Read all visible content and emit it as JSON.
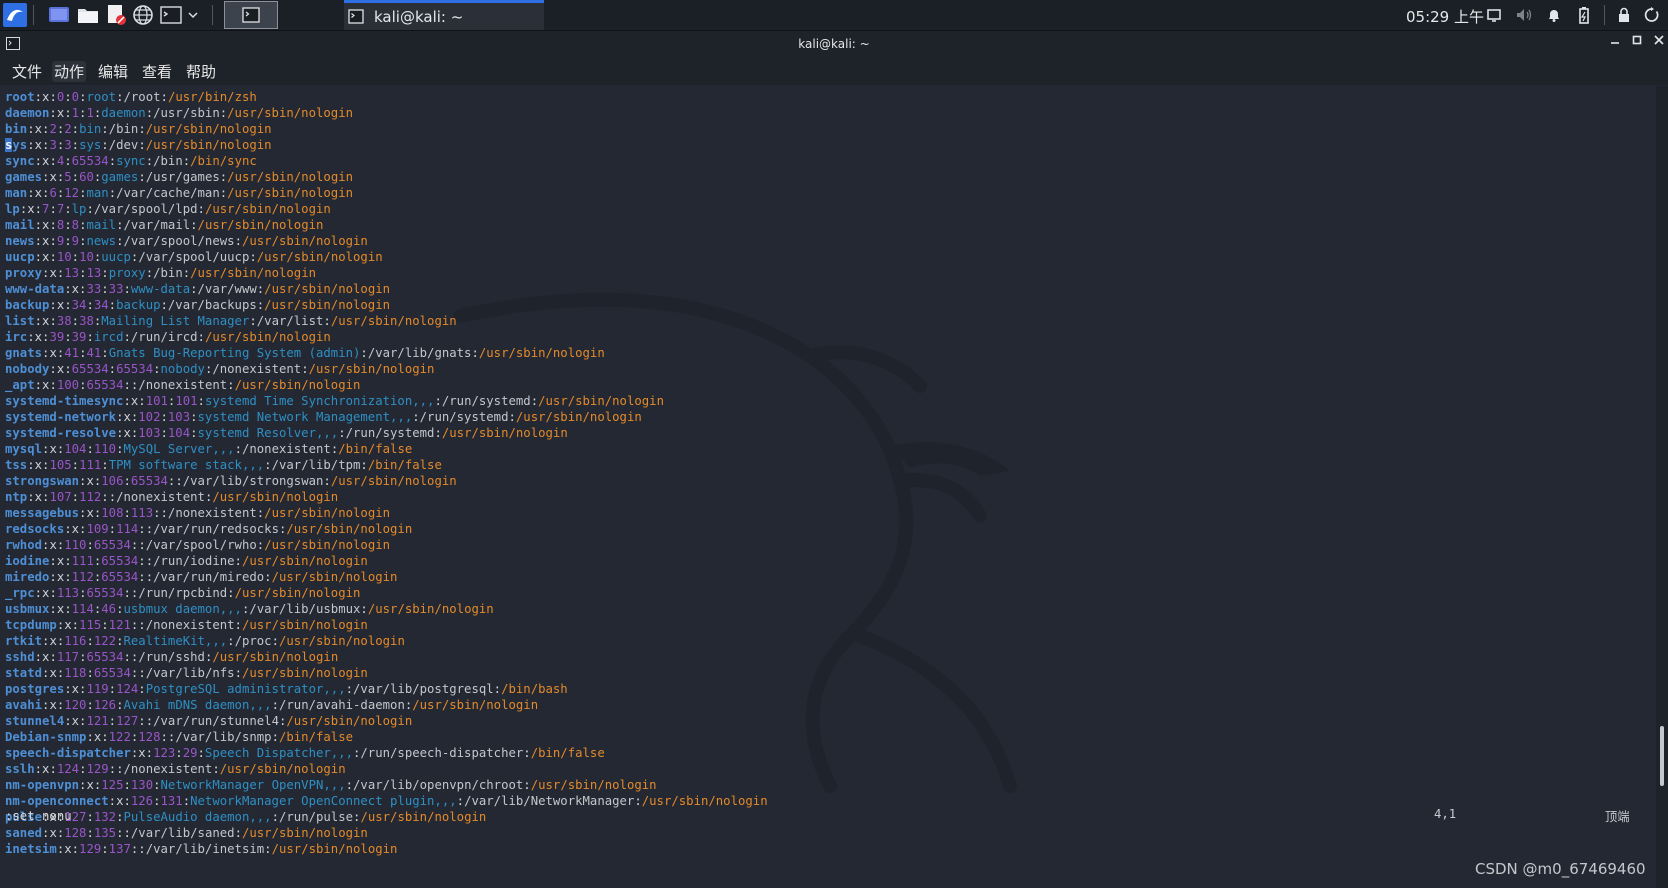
{
  "taskbar": {
    "app_title": "kali@kali: ~",
    "clock": "05:29 上午"
  },
  "window": {
    "title": "kali@kali: ~"
  },
  "menu": {
    "file": "文件",
    "action": "动作",
    "edit": "编辑",
    "view": "查看",
    "help": "帮助"
  },
  "terminal": {
    "lines": [
      [
        "root",
        "x",
        "0",
        "0",
        "root",
        "/root",
        "/usr/bin/zsh"
      ],
      [
        "daemon",
        "x",
        "1",
        "1",
        "daemon",
        "/usr/sbin",
        "/usr/sbin/nologin"
      ],
      [
        "bin",
        "x",
        "2",
        "2",
        "bin",
        "/bin",
        "/usr/sbin/nologin"
      ],
      [
        "sys",
        "x",
        "3",
        "3",
        "sys",
        "/dev",
        "/usr/sbin/nologin"
      ],
      [
        "sync",
        "x",
        "4",
        "65534",
        "sync",
        "/bin",
        "/bin/sync"
      ],
      [
        "games",
        "x",
        "5",
        "60",
        "games",
        "/usr/games",
        "/usr/sbin/nologin"
      ],
      [
        "man",
        "x",
        "6",
        "12",
        "man",
        "/var/cache/man",
        "/usr/sbin/nologin"
      ],
      [
        "lp",
        "x",
        "7",
        "7",
        "lp",
        "/var/spool/lpd",
        "/usr/sbin/nologin"
      ],
      [
        "mail",
        "x",
        "8",
        "8",
        "mail",
        "/var/mail",
        "/usr/sbin/nologin"
      ],
      [
        "news",
        "x",
        "9",
        "9",
        "news",
        "/var/spool/news",
        "/usr/sbin/nologin"
      ],
      [
        "uucp",
        "x",
        "10",
        "10",
        "uucp",
        "/var/spool/uucp",
        "/usr/sbin/nologin"
      ],
      [
        "proxy",
        "x",
        "13",
        "13",
        "proxy",
        "/bin",
        "/usr/sbin/nologin"
      ],
      [
        "www-data",
        "x",
        "33",
        "33",
        "www-data",
        "/var/www",
        "/usr/sbin/nologin"
      ],
      [
        "backup",
        "x",
        "34",
        "34",
        "backup",
        "/var/backups",
        "/usr/sbin/nologin"
      ],
      [
        "list",
        "x",
        "38",
        "38",
        "Mailing List Manager",
        "/var/list",
        "/usr/sbin/nologin"
      ],
      [
        "irc",
        "x",
        "39",
        "39",
        "ircd",
        "/run/ircd",
        "/usr/sbin/nologin"
      ],
      [
        "gnats",
        "x",
        "41",
        "41",
        "Gnats Bug-Reporting System (admin)",
        "/var/lib/gnats",
        "/usr/sbin/nologin"
      ],
      [
        "nobody",
        "x",
        "65534",
        "65534",
        "nobody",
        "/nonexistent",
        "/usr/sbin/nologin"
      ],
      [
        "_apt",
        "x",
        "100",
        "65534",
        "",
        "/nonexistent",
        "/usr/sbin/nologin"
      ],
      [
        "systemd-timesync",
        "x",
        "101",
        "101",
        "systemd Time Synchronization,,,",
        "/run/systemd",
        "/usr/sbin/nologin"
      ],
      [
        "systemd-network",
        "x",
        "102",
        "103",
        "systemd Network Management,,,",
        "/run/systemd",
        "/usr/sbin/nologin"
      ],
      [
        "systemd-resolve",
        "x",
        "103",
        "104",
        "systemd Resolver,,,",
        "/run/systemd",
        "/usr/sbin/nologin"
      ],
      [
        "mysql",
        "x",
        "104",
        "110",
        "MySQL Server,,,",
        "/nonexistent",
        "/bin/false"
      ],
      [
        "tss",
        "x",
        "105",
        "111",
        "TPM software stack,,,",
        "/var/lib/tpm",
        "/bin/false"
      ],
      [
        "strongswan",
        "x",
        "106",
        "65534",
        "",
        "/var/lib/strongswan",
        "/usr/sbin/nologin"
      ],
      [
        "ntp",
        "x",
        "107",
        "112",
        "",
        "/nonexistent",
        "/usr/sbin/nologin"
      ],
      [
        "messagebus",
        "x",
        "108",
        "113",
        "",
        "/nonexistent",
        "/usr/sbin/nologin"
      ],
      [
        "redsocks",
        "x",
        "109",
        "114",
        "",
        "/var/run/redsocks",
        "/usr/sbin/nologin"
      ],
      [
        "rwhod",
        "x",
        "110",
        "65534",
        "",
        "/var/spool/rwho",
        "/usr/sbin/nologin"
      ],
      [
        "iodine",
        "x",
        "111",
        "65534",
        "",
        "/run/iodine",
        "/usr/sbin/nologin"
      ],
      [
        "miredo",
        "x",
        "112",
        "65534",
        "",
        "/var/run/miredo",
        "/usr/sbin/nologin"
      ],
      [
        "_rpc",
        "x",
        "113",
        "65534",
        "",
        "/run/rpcbind",
        "/usr/sbin/nologin"
      ],
      [
        "usbmux",
        "x",
        "114",
        "46",
        "usbmux daemon,,,",
        "/var/lib/usbmux",
        "/usr/sbin/nologin"
      ],
      [
        "tcpdump",
        "x",
        "115",
        "121",
        "",
        "/nonexistent",
        "/usr/sbin/nologin"
      ],
      [
        "rtkit",
        "x",
        "116",
        "122",
        "RealtimeKit,,,",
        "/proc",
        "/usr/sbin/nologin"
      ],
      [
        "sshd",
        "x",
        "117",
        "65534",
        "",
        "/run/sshd",
        "/usr/sbin/nologin"
      ],
      [
        "statd",
        "x",
        "118",
        "65534",
        "",
        "/var/lib/nfs",
        "/usr/sbin/nologin"
      ],
      [
        "postgres",
        "x",
        "119",
        "124",
        "PostgreSQL administrator,,,",
        "/var/lib/postgresql",
        "/bin/bash"
      ],
      [
        "avahi",
        "x",
        "120",
        "126",
        "Avahi mDNS daemon,,,",
        "/run/avahi-daemon",
        "/usr/sbin/nologin"
      ],
      [
        "stunnel4",
        "x",
        "121",
        "127",
        "",
        "/var/run/stunnel4",
        "/usr/sbin/nologin"
      ],
      [
        "Debian-snmp",
        "x",
        "122",
        "128",
        "",
        "/var/lib/snmp",
        "/bin/false"
      ],
      [
        "speech-dispatcher",
        "x",
        "123",
        "29",
        "Speech Dispatcher,,,",
        "/run/speech-dispatcher",
        "/bin/false"
      ],
      [
        "sslh",
        "x",
        "124",
        "129",
        "",
        "/nonexistent",
        "/usr/sbin/nologin"
      ],
      [
        "nm-openvpn",
        "x",
        "125",
        "130",
        "NetworkManager OpenVPN,,,",
        "/var/lib/openvpn/chroot",
        "/usr/sbin/nologin"
      ],
      [
        "nm-openconnect",
        "x",
        "126",
        "131",
        "NetworkManager OpenConnect plugin,,,",
        "/var/lib/NetworkManager",
        "/usr/sbin/nologin"
      ],
      [
        "pulse",
        "x",
        "127",
        "132",
        "PulseAudio daemon,,,",
        "/run/pulse",
        "/usr/sbin/nologin"
      ],
      [
        "saned",
        "x",
        "128",
        "135",
        "",
        "/var/lib/saned",
        "/usr/sbin/nologin"
      ],
      [
        "inetsim",
        "x",
        "129",
        "137",
        "",
        "/var/lib/inetsim",
        "/usr/sbin/nologin"
      ]
    ],
    "command_line": ":set nonu",
    "cursor_position": "4,1",
    "scroll_position": "顶端"
  },
  "watermark": "CSDN @m0_67469460",
  "colors": {
    "background": "#232832",
    "username": "#4e8fd6",
    "id": "#9a55c8",
    "gecos": "#2f8fc5",
    "shell": "#e38a2b",
    "accent": "#2f6fe4"
  }
}
